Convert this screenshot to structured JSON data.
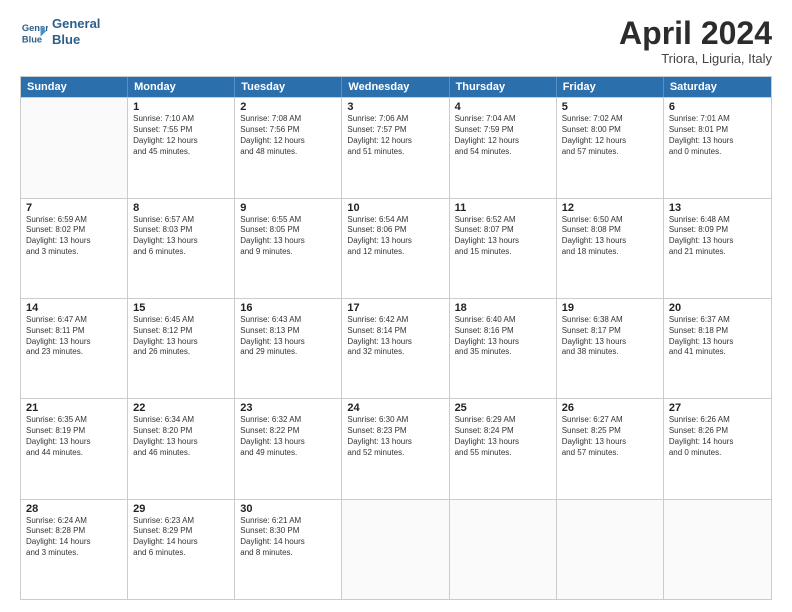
{
  "logo": {
    "line1": "General",
    "line2": "Blue"
  },
  "title": "April 2024",
  "location": "Triora, Liguria, Italy",
  "header_days": [
    "Sunday",
    "Monday",
    "Tuesday",
    "Wednesday",
    "Thursday",
    "Friday",
    "Saturday"
  ],
  "rows": [
    [
      {
        "day": "",
        "info": ""
      },
      {
        "day": "1",
        "info": "Sunrise: 7:10 AM\nSunset: 7:55 PM\nDaylight: 12 hours\nand 45 minutes."
      },
      {
        "day": "2",
        "info": "Sunrise: 7:08 AM\nSunset: 7:56 PM\nDaylight: 12 hours\nand 48 minutes."
      },
      {
        "day": "3",
        "info": "Sunrise: 7:06 AM\nSunset: 7:57 PM\nDaylight: 12 hours\nand 51 minutes."
      },
      {
        "day": "4",
        "info": "Sunrise: 7:04 AM\nSunset: 7:59 PM\nDaylight: 12 hours\nand 54 minutes."
      },
      {
        "day": "5",
        "info": "Sunrise: 7:02 AM\nSunset: 8:00 PM\nDaylight: 12 hours\nand 57 minutes."
      },
      {
        "day": "6",
        "info": "Sunrise: 7:01 AM\nSunset: 8:01 PM\nDaylight: 13 hours\nand 0 minutes."
      }
    ],
    [
      {
        "day": "7",
        "info": "Sunrise: 6:59 AM\nSunset: 8:02 PM\nDaylight: 13 hours\nand 3 minutes."
      },
      {
        "day": "8",
        "info": "Sunrise: 6:57 AM\nSunset: 8:03 PM\nDaylight: 13 hours\nand 6 minutes."
      },
      {
        "day": "9",
        "info": "Sunrise: 6:55 AM\nSunset: 8:05 PM\nDaylight: 13 hours\nand 9 minutes."
      },
      {
        "day": "10",
        "info": "Sunrise: 6:54 AM\nSunset: 8:06 PM\nDaylight: 13 hours\nand 12 minutes."
      },
      {
        "day": "11",
        "info": "Sunrise: 6:52 AM\nSunset: 8:07 PM\nDaylight: 13 hours\nand 15 minutes."
      },
      {
        "day": "12",
        "info": "Sunrise: 6:50 AM\nSunset: 8:08 PM\nDaylight: 13 hours\nand 18 minutes."
      },
      {
        "day": "13",
        "info": "Sunrise: 6:48 AM\nSunset: 8:09 PM\nDaylight: 13 hours\nand 21 minutes."
      }
    ],
    [
      {
        "day": "14",
        "info": "Sunrise: 6:47 AM\nSunset: 8:11 PM\nDaylight: 13 hours\nand 23 minutes."
      },
      {
        "day": "15",
        "info": "Sunrise: 6:45 AM\nSunset: 8:12 PM\nDaylight: 13 hours\nand 26 minutes."
      },
      {
        "day": "16",
        "info": "Sunrise: 6:43 AM\nSunset: 8:13 PM\nDaylight: 13 hours\nand 29 minutes."
      },
      {
        "day": "17",
        "info": "Sunrise: 6:42 AM\nSunset: 8:14 PM\nDaylight: 13 hours\nand 32 minutes."
      },
      {
        "day": "18",
        "info": "Sunrise: 6:40 AM\nSunset: 8:16 PM\nDaylight: 13 hours\nand 35 minutes."
      },
      {
        "day": "19",
        "info": "Sunrise: 6:38 AM\nSunset: 8:17 PM\nDaylight: 13 hours\nand 38 minutes."
      },
      {
        "day": "20",
        "info": "Sunrise: 6:37 AM\nSunset: 8:18 PM\nDaylight: 13 hours\nand 41 minutes."
      }
    ],
    [
      {
        "day": "21",
        "info": "Sunrise: 6:35 AM\nSunset: 8:19 PM\nDaylight: 13 hours\nand 44 minutes."
      },
      {
        "day": "22",
        "info": "Sunrise: 6:34 AM\nSunset: 8:20 PM\nDaylight: 13 hours\nand 46 minutes."
      },
      {
        "day": "23",
        "info": "Sunrise: 6:32 AM\nSunset: 8:22 PM\nDaylight: 13 hours\nand 49 minutes."
      },
      {
        "day": "24",
        "info": "Sunrise: 6:30 AM\nSunset: 8:23 PM\nDaylight: 13 hours\nand 52 minutes."
      },
      {
        "day": "25",
        "info": "Sunrise: 6:29 AM\nSunset: 8:24 PM\nDaylight: 13 hours\nand 55 minutes."
      },
      {
        "day": "26",
        "info": "Sunrise: 6:27 AM\nSunset: 8:25 PM\nDaylight: 13 hours\nand 57 minutes."
      },
      {
        "day": "27",
        "info": "Sunrise: 6:26 AM\nSunset: 8:26 PM\nDaylight: 14 hours\nand 0 minutes."
      }
    ],
    [
      {
        "day": "28",
        "info": "Sunrise: 6:24 AM\nSunset: 8:28 PM\nDaylight: 14 hours\nand 3 minutes."
      },
      {
        "day": "29",
        "info": "Sunrise: 6:23 AM\nSunset: 8:29 PM\nDaylight: 14 hours\nand 6 minutes."
      },
      {
        "day": "30",
        "info": "Sunrise: 6:21 AM\nSunset: 8:30 PM\nDaylight: 14 hours\nand 8 minutes."
      },
      {
        "day": "",
        "info": ""
      },
      {
        "day": "",
        "info": ""
      },
      {
        "day": "",
        "info": ""
      },
      {
        "day": "",
        "info": ""
      }
    ]
  ]
}
